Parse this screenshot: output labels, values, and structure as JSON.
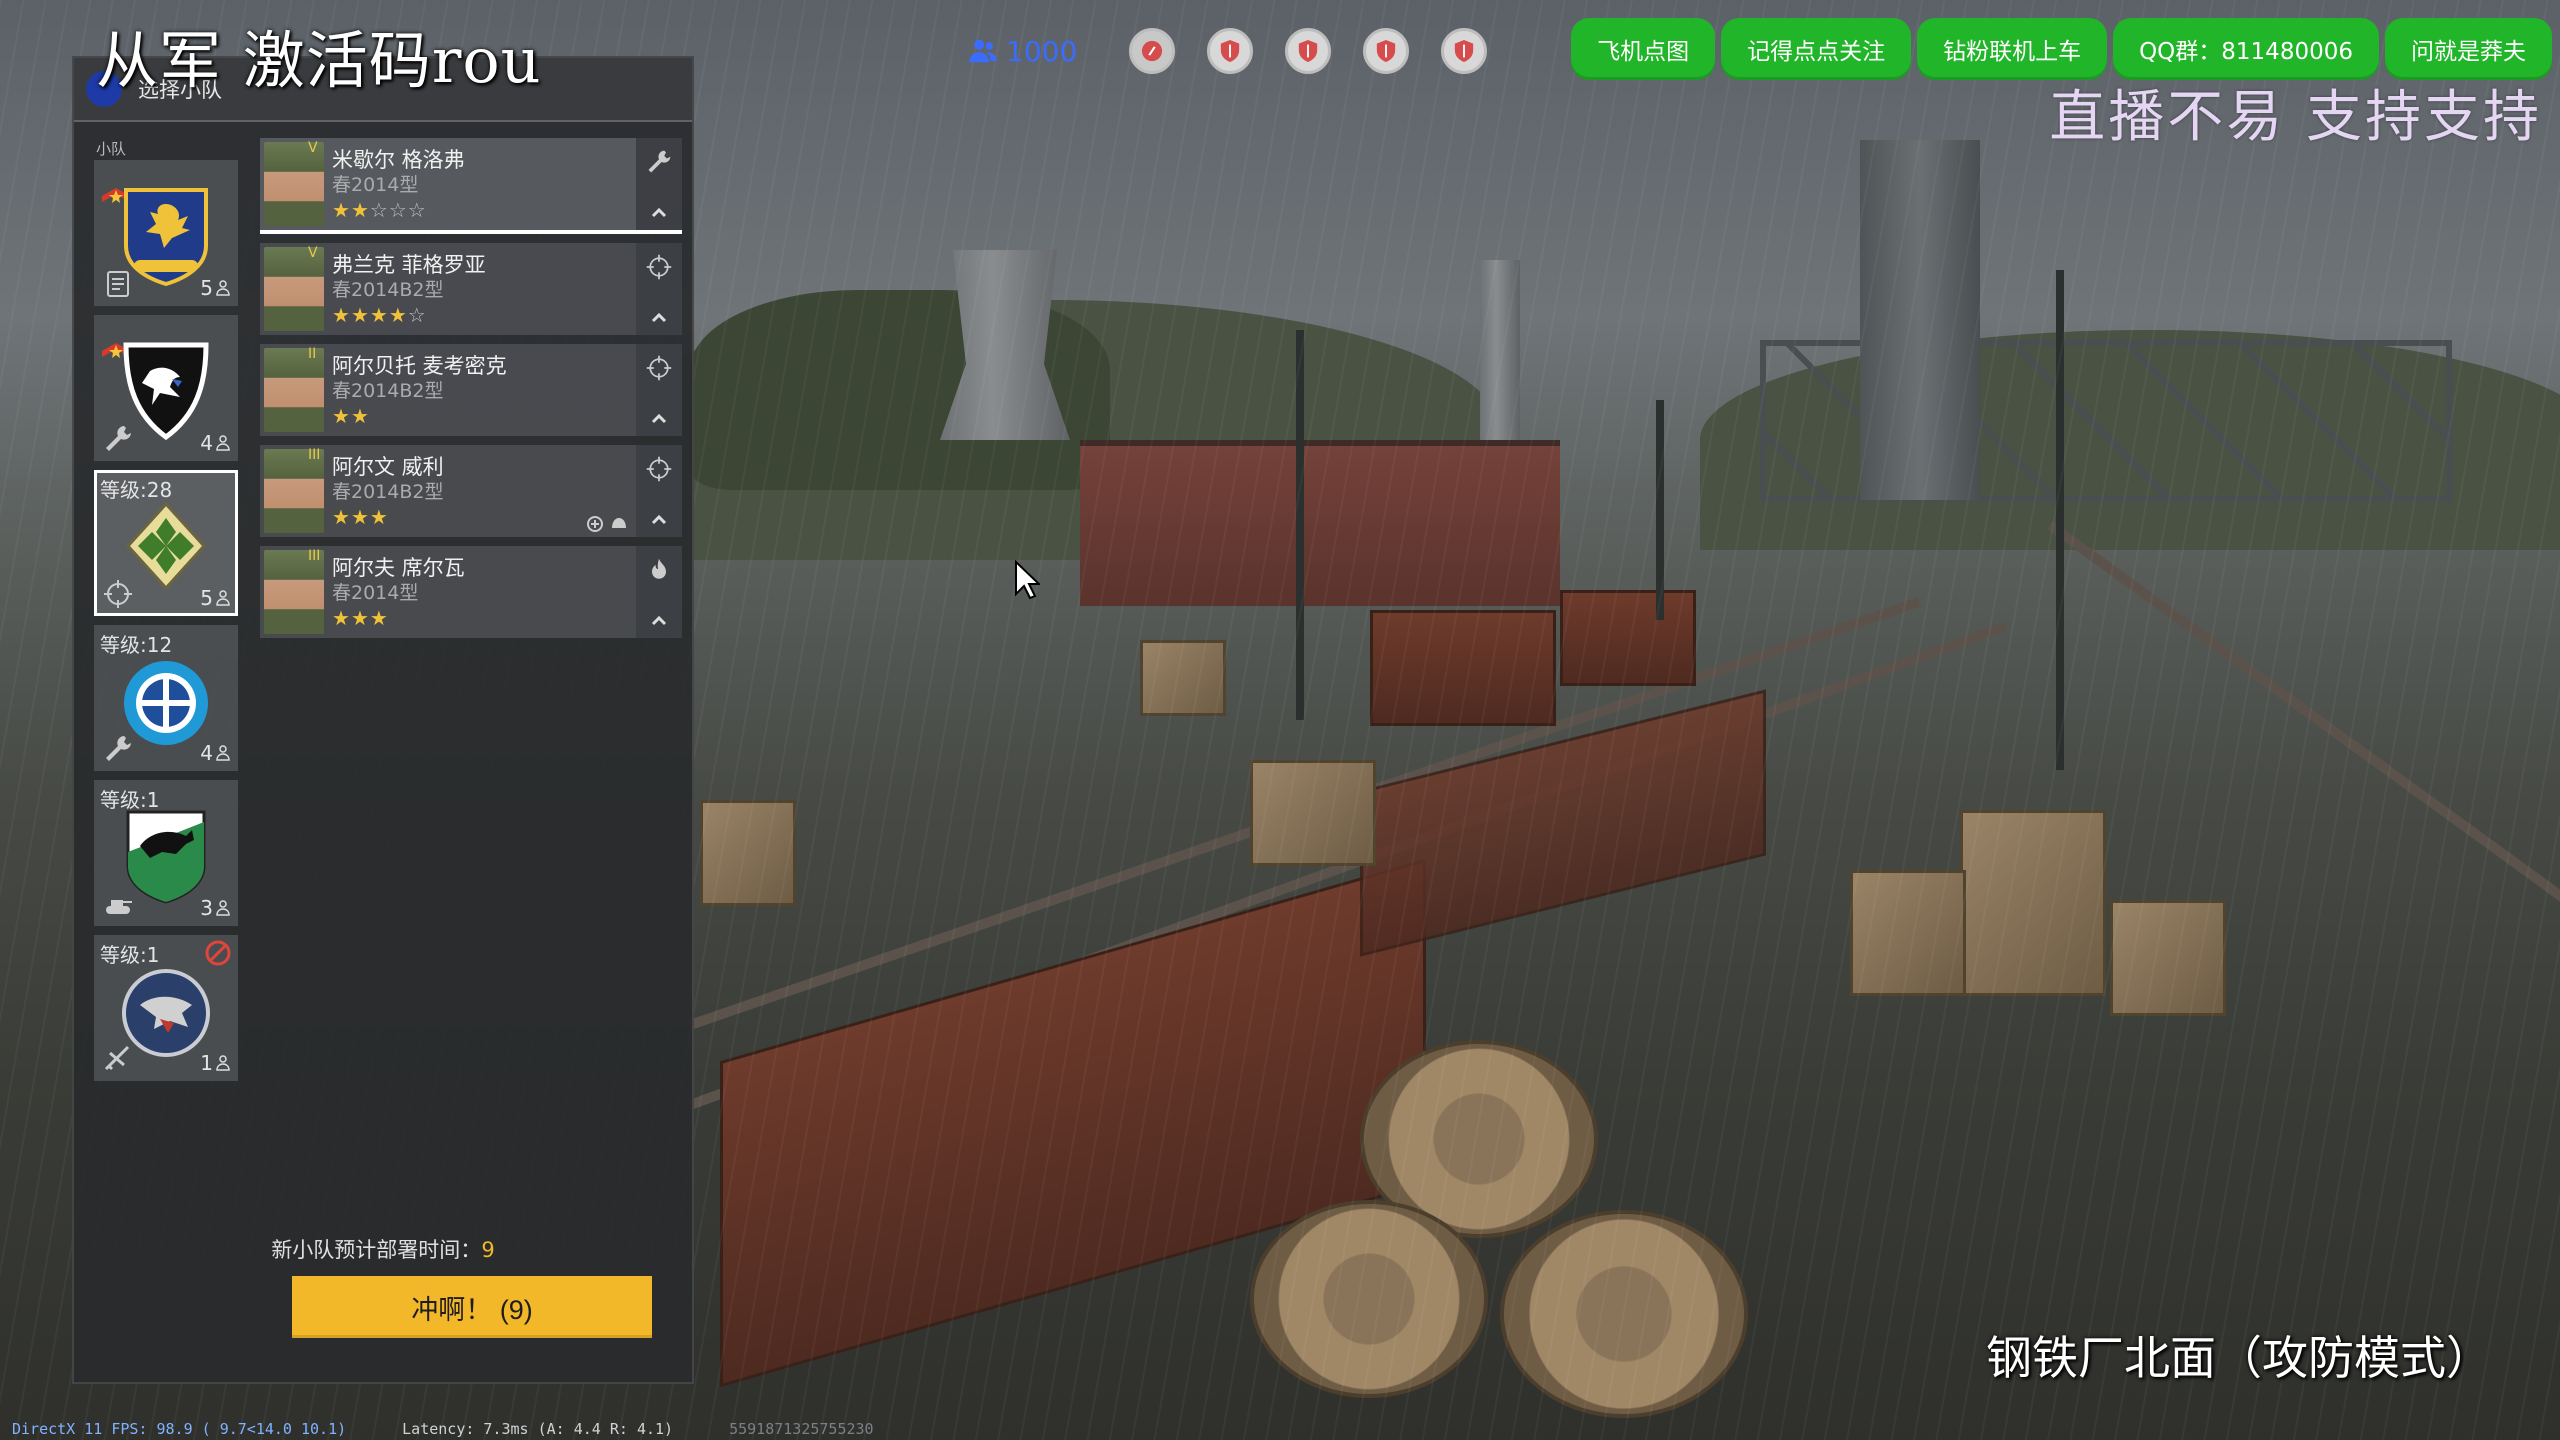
{
  "overlay": {
    "stream_title": "从军 激活码rou",
    "slogan": "直播不易 支持支持",
    "map_name": "钢铁厂北面（攻防模式）",
    "debug_fps": "DirectX 11 FPS: 98.9 ( 9.7<14.0 10.1)",
    "debug_latency": "Latency:  7.3ms (A:  4.4 R:  4.1)",
    "debug_id": "5591871325755230"
  },
  "hud": {
    "player_count": "1000",
    "objectives": [
      {
        "icon": "lock-icon",
        "color": "#d64b4b"
      },
      {
        "icon": "shield-icon",
        "color": "#d64b4b"
      },
      {
        "icon": "shield-icon",
        "color": "#d64b4b"
      },
      {
        "icon": "shield-icon",
        "color": "#d64b4b"
      },
      {
        "icon": "shield-icon",
        "color": "#d64b4b"
      }
    ]
  },
  "top_buttons": [
    {
      "label": "飞机点图"
    },
    {
      "label": "记得点点关注"
    },
    {
      "label": "钻粉联机上车"
    },
    {
      "label": "QQ群：811480006"
    },
    {
      "label": "问就是莽夫"
    }
  ],
  "panel": {
    "header": "选择小队",
    "squads_label": "小队",
    "squads": [
      {
        "level": "",
        "count": "5",
        "type_icon": "engineer-list-icon",
        "emblem": "eagle-strike-emblem",
        "selected": false
      },
      {
        "level": "",
        "count": "4",
        "type_icon": "wrench-icon",
        "emblem": "eagle-shield-emblem",
        "selected": false
      },
      {
        "level": "等级:28",
        "count": "5",
        "type_icon": "crosshair-icon",
        "emblem": "ivy-diamond-emblem",
        "selected": true
      },
      {
        "level": "等级:12",
        "count": "4",
        "type_icon": "wrench-icon",
        "emblem": "blue-cross-emblem",
        "selected": false
      },
      {
        "level": "等级:1",
        "count": "3",
        "type_icon": "tank-icon",
        "emblem": "panther-shield-emblem",
        "selected": false
      },
      {
        "level": "等级:1",
        "count": "1",
        "type_icon": "plane-icon",
        "emblem": "eagle-bomb-emblem",
        "selected": false
      }
    ],
    "soldiers": [
      {
        "tier": "V",
        "name": "米歇尔 格洛弗",
        "weapon": "春2014型",
        "stars": 2,
        "max_stars": 5,
        "role_icon": "wrench-icon"
      },
      {
        "tier": "V",
        "name": "弗兰克 菲格罗亚",
        "weapon": "春2014B2型",
        "stars": 4,
        "max_stars": 5,
        "role_icon": "crosshair-icon"
      },
      {
        "tier": "II",
        "name": "阿尔贝托 麦考密克",
        "weapon": "春2014B2型",
        "stars": 2,
        "max_stars": 2,
        "role_icon": "crosshair-icon"
      },
      {
        "tier": "III",
        "name": "阿尔文 威利",
        "weapon": "春2014B2型",
        "stars": 3,
        "max_stars": 3,
        "role_icon": "crosshair-icon"
      },
      {
        "tier": "III",
        "name": "阿尔夫 席尔瓦",
        "weapon": "春2014型",
        "stars": 3,
        "max_stars": 3,
        "role_icon": "flame-icon"
      }
    ],
    "deploy_label": "新小队预计部署时间：",
    "deploy_value": "9",
    "charge_label": "冲啊！ (9)"
  }
}
